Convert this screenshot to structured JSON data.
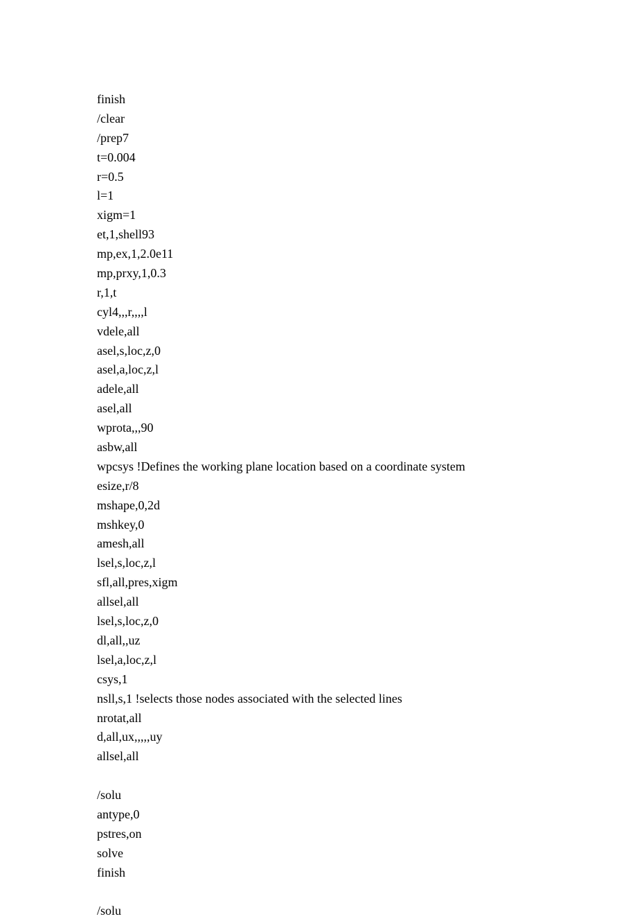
{
  "code_lines": [
    "finish",
    "/clear",
    "/prep7",
    "t=0.004",
    "r=0.5",
    "l=1",
    "xigm=1",
    "et,1,shell93",
    "mp,ex,1,2.0e11",
    "mp,prxy,1,0.3",
    "r,1,t",
    "cyl4,,,r,,,,l",
    "vdele,all",
    "asel,s,loc,z,0",
    "asel,a,loc,z,l",
    "adele,all",
    "asel,all",
    "wprota,,,90",
    "asbw,all",
    "wpcsys !Defines the working plane location based on a coordinate system",
    "esize,r/8",
    "mshape,0,2d",
    "mshkey,0",
    "amesh,all",
    "lsel,s,loc,z,l",
    "sfl,all,pres,xigm",
    "allsel,all",
    "lsel,s,loc,z,0",
    "dl,all,,uz",
    "lsel,a,loc,z,l",
    "csys,1",
    "nsll,s,1 !selects those nodes associated with the selected lines",
    "nrotat,all",
    "d,all,ux,,,,,uy",
    "allsel,all",
    "",
    "/solu",
    "antype,0",
    "pstres,on",
    "solve",
    "finish",
    "",
    "/solu"
  ]
}
